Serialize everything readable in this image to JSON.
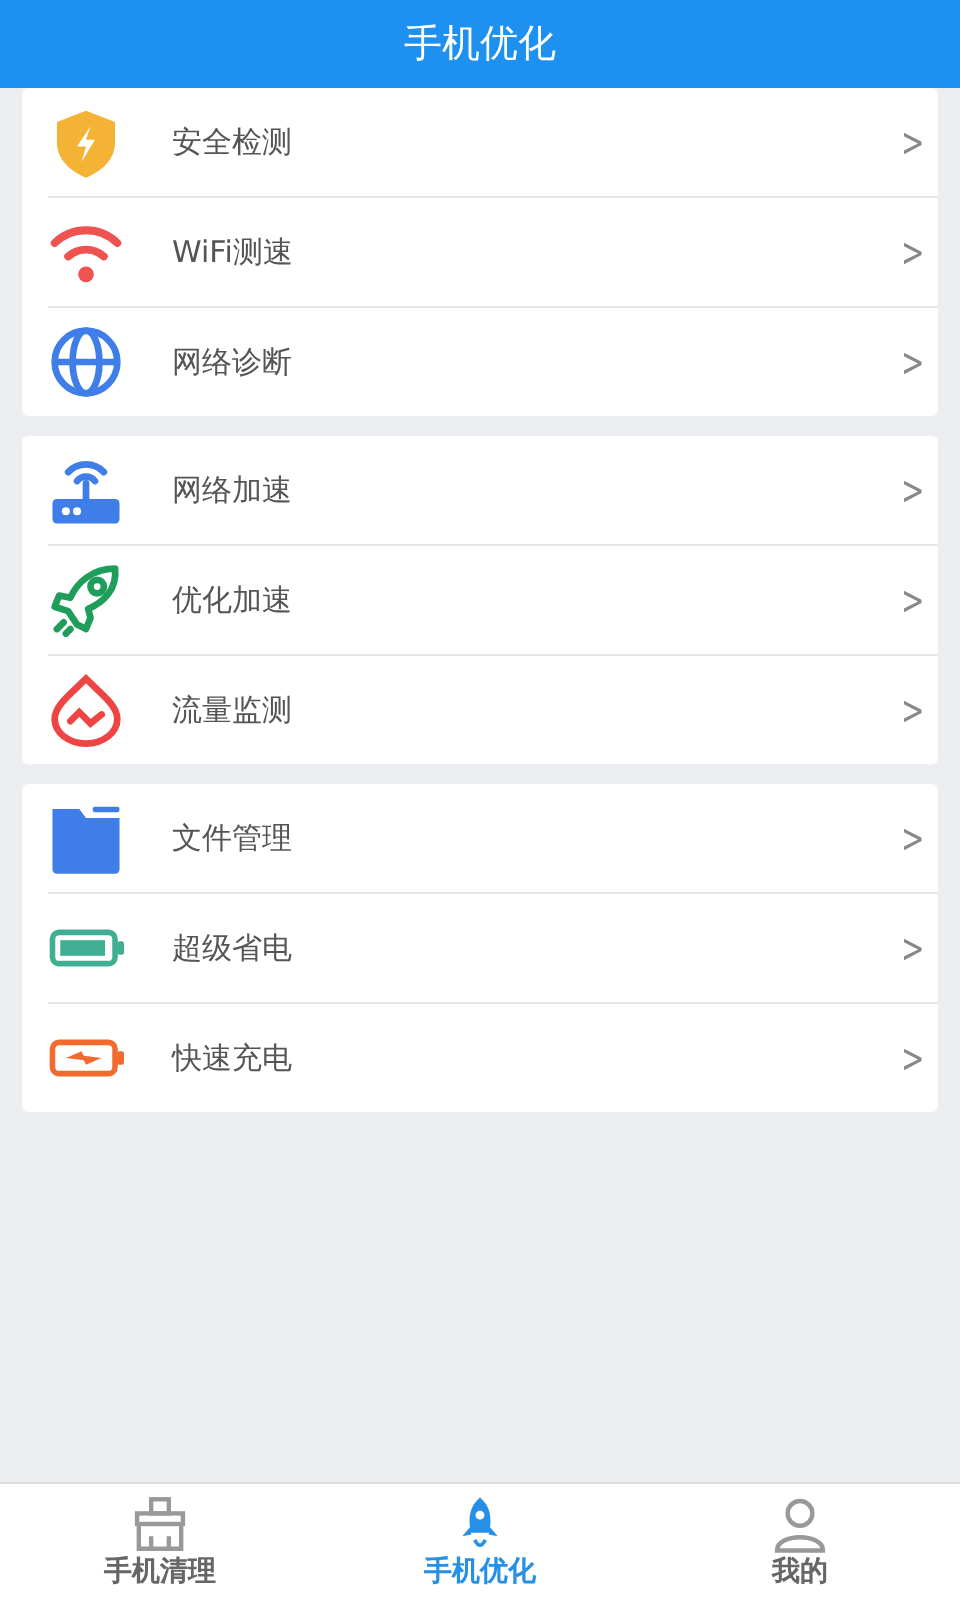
{
  "header": {
    "title": "手机优化"
  },
  "groups": [
    {
      "items": [
        {
          "kind": "shield",
          "label": "安全检测",
          "chevron": ">"
        },
        {
          "kind": "wifi",
          "label": "WiFi测速",
          "chevron": ">"
        },
        {
          "kind": "globe",
          "label": "网络诊断",
          "chevron": ">"
        }
      ]
    },
    {
      "items": [
        {
          "kind": "router",
          "label": "网络加速",
          "chevron": ">"
        },
        {
          "kind": "rocket",
          "label": "优化加速",
          "chevron": ">"
        },
        {
          "kind": "drop",
          "label": "流量监测",
          "chevron": ">"
        }
      ]
    },
    {
      "items": [
        {
          "kind": "folder",
          "label": "文件管理",
          "chevron": ">"
        },
        {
          "kind": "battery",
          "label": "超级省电",
          "chevron": ">"
        },
        {
          "kind": "charge",
          "label": "快速充电",
          "chevron": ">"
        }
      ]
    }
  ],
  "tabs": [
    {
      "kind": "broom",
      "label": "手机清理",
      "selected": false
    },
    {
      "kind": "rocket",
      "label": "手机优化",
      "selected": true
    },
    {
      "kind": "person",
      "label": "我的",
      "selected": false
    }
  ]
}
